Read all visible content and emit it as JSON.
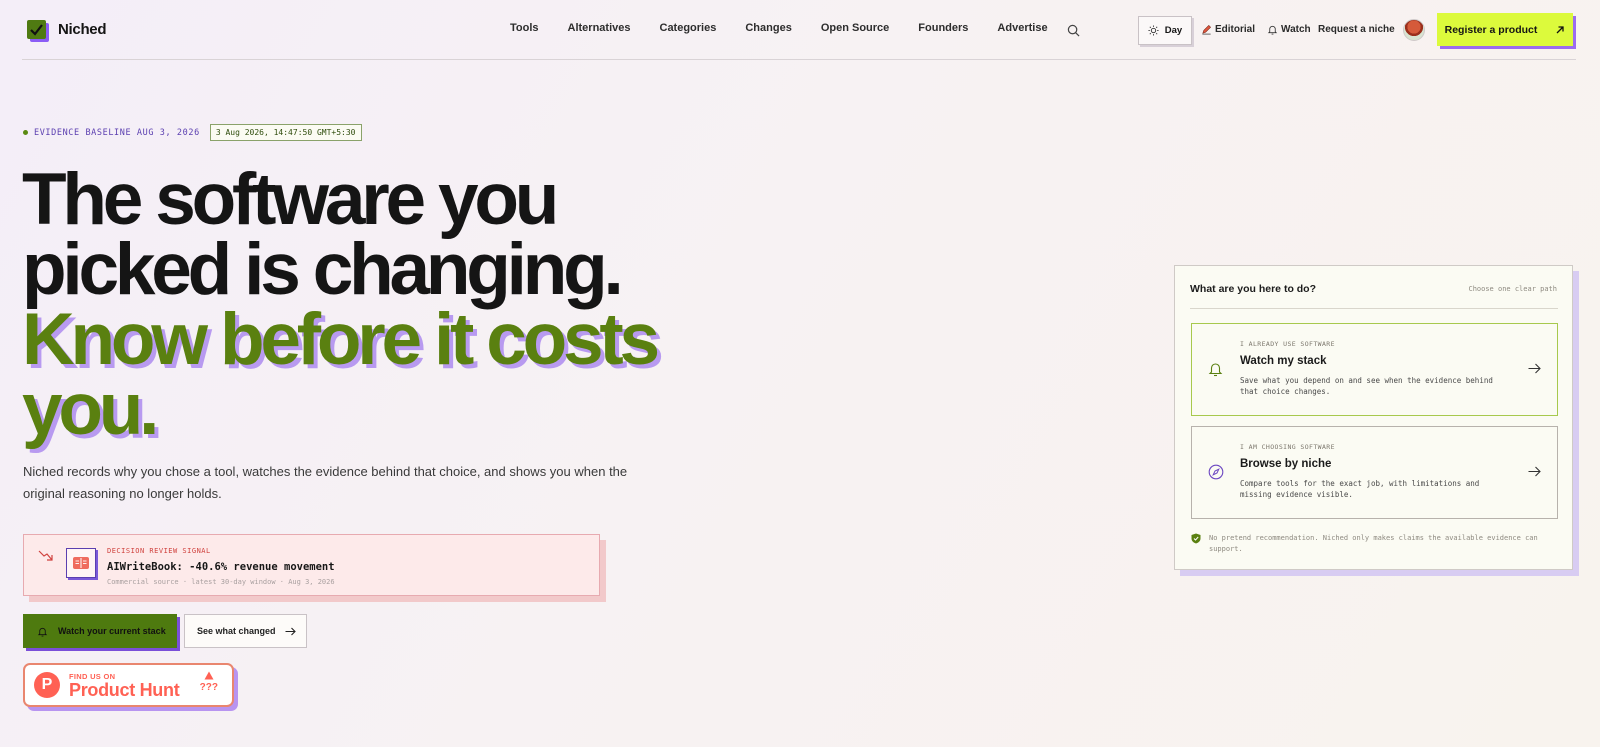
{
  "brand": {
    "name": "Niched"
  },
  "nav": {
    "links": [
      "Tools",
      "Alternatives",
      "Categories",
      "Changes",
      "Open Source",
      "Founders",
      "Advertise"
    ],
    "theme_label": "Day",
    "editorial": "Editorial",
    "watch": "Watch",
    "request": "Request a niche",
    "register": "Register a product"
  },
  "hero": {
    "baseline_label": "EVIDENCE BASELINE AUG 3, 2026",
    "timestamp": "3 Aug 2026, 14:47:50 GMT+5:30",
    "headline_line1": "The software you",
    "headline_line2": "picked is changing.",
    "headline_line3": "Know before it costs",
    "headline_line4": "you.",
    "lead": "Niched records why you chose a tool, watches the evidence behind that choice, and shows you when the original reasoning no longer holds."
  },
  "signal": {
    "kicker": "DECISION REVIEW SIGNAL",
    "title": "AIWriteBook: -40.6% revenue movement",
    "meta": "Commercial source · latest 30-day window · Aug 3, 2026"
  },
  "cta": {
    "watch_label": "Watch your current stack",
    "changed_label": "See what changed"
  },
  "product_hunt": {
    "small": "FIND US ON",
    "big": "Product Hunt",
    "votes": "???"
  },
  "panel": {
    "title": "What are you here to do?",
    "hint": "Choose one clear path",
    "options": [
      {
        "kicker": "I ALREADY USE SOFTWARE",
        "title": "Watch my stack",
        "desc": "Save what you depend on and see when the evidence behind that choice changes.",
        "icon": "bell-icon"
      },
      {
        "kicker": "I AM CHOOSING SOFTWARE",
        "title": "Browse by niche",
        "desc": "Compare tools for the exact job, with limitations and missing evidence visible.",
        "icon": "compass-icon"
      }
    ],
    "note": "No pretend recommendation. Niched only makes claims the available evidence can support."
  },
  "colors": {
    "accent_green": "#5a8010",
    "accent_lime": "#dcfa3c",
    "accent_purple": "#8b5cf6",
    "signal_red": "#d0423e",
    "product_hunt": "#ff6154"
  }
}
